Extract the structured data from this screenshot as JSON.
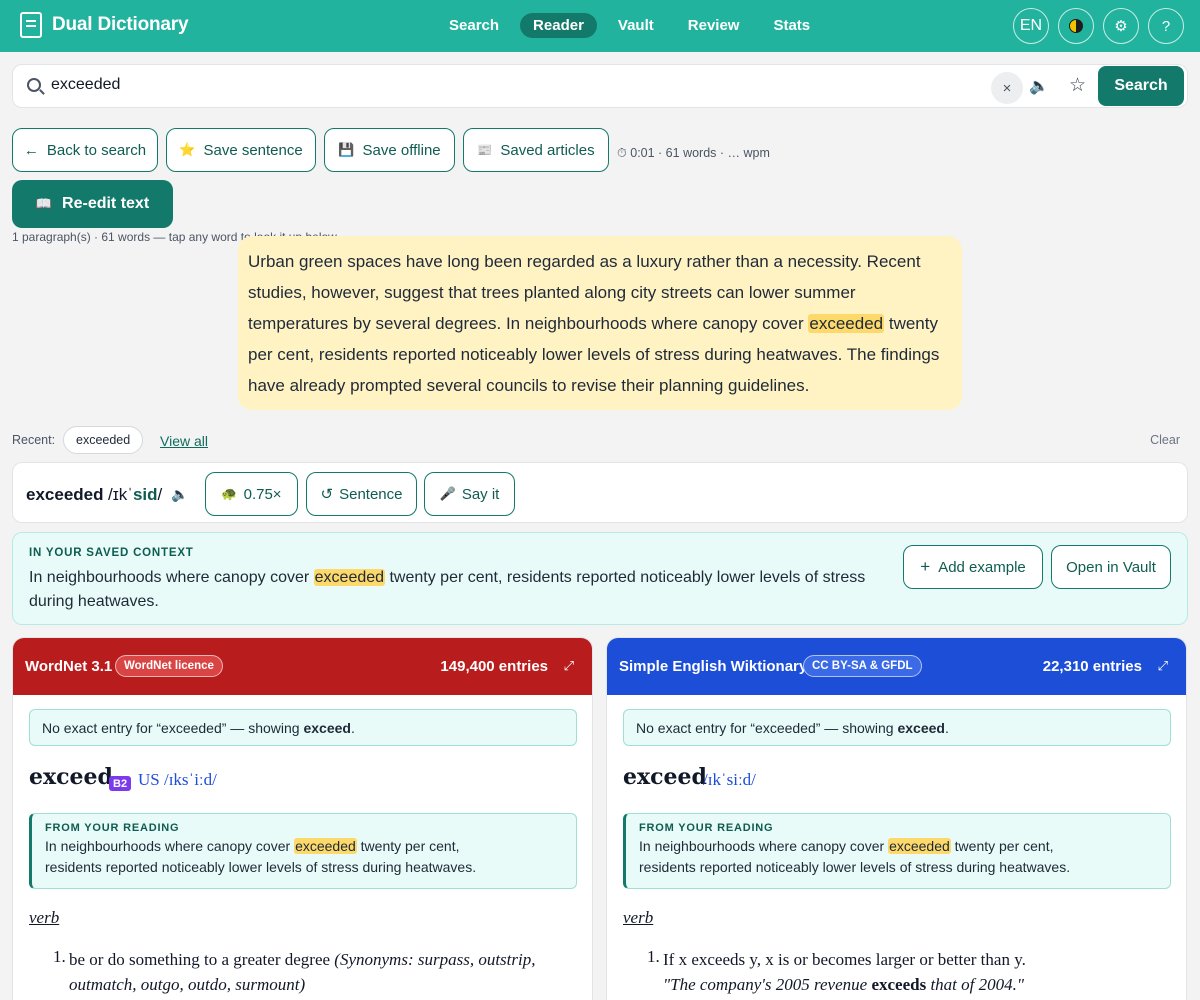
{
  "app": {
    "title": "Dual Dictionary"
  },
  "nav": [
    "Search",
    "Reader",
    "Vault",
    "Review",
    "Stats"
  ],
  "nav_active": "Reader",
  "top_actions": {
    "lang": "EN",
    "settings": "⚙",
    "help": "?"
  },
  "search": {
    "value": "exceeded",
    "clear": "×",
    "button": "Search"
  },
  "actions": {
    "back": "Back to search",
    "save_sentence": "Save sentence",
    "save_offline": "Save offline",
    "saved_articles": "Saved articles",
    "timer": "0:01 · 61 words · … wpm",
    "reedit": "Re-edit text",
    "para_meta": "1 paragraph(s) · 61 words — tap any word to look it up below."
  },
  "passage": {
    "before": "Urban green spaces have long been regarded as a luxury rather than a necessity. Recent studies, however, suggest that trees planted along city streets can lower summer temperatures by several degrees. In neighbourhoods where canopy cover ",
    "highlight": "exceeded",
    "after": " twenty per cent, residents reported noticeably lower levels of stress during heatwaves. The findings have already prompted several councils to revise their planning guidelines."
  },
  "recent": {
    "label": "Recent:",
    "chip": "exceeded",
    "view_all": "View all",
    "clear": "Clear"
  },
  "word": {
    "headword": "exceeded",
    "ipa_start": "/ɪkˈ",
    "ipa_stress": "sid",
    "ipa_end": "/",
    "speed": "0.75×",
    "sentence": "Sentence",
    "say_it": "Say it"
  },
  "context": {
    "label": "IN YOUR SAVED CONTEXT",
    "before": "In neighbourhoods where canopy cover ",
    "highlight": "exceeded",
    "after": " twenty per cent, residents reported noticeably lower levels of stress during heatwaves.",
    "add_example": "Add example",
    "open_vault": "Open in Vault"
  },
  "panes": [
    {
      "title": "WordNet 3.1",
      "licence": "WordNet licence",
      "entries": "149,400 entries",
      "color": "#b91c1c",
      "notice_before": "No exact entry for “exceeded” — showing ",
      "notice_word": "exceed",
      "notice_after": ".",
      "headword": "exceed",
      "level": "B2",
      "pron": "US /ɪksˈiːd/",
      "reading_label": "FROM YOUR READING",
      "reading_before": "In neighbourhoods where canopy cover ",
      "reading_highlight": "exceeded",
      "reading_after": " twenty per cent, residents reported noticeably lower levels of stress during heatwaves.",
      "pos": "verb",
      "def_num": "1.",
      "def_text": "be or do something to a greater degree ",
      "def_syn": "(Synonyms: surpass, outstrip, outmatch, outgo, outdo, surmount)"
    },
    {
      "title": "Simple English Wiktionary",
      "licence": "CC BY-SA & GFDL",
      "entries": "22,310 entries",
      "color": "#1d4ed8",
      "notice_before": "No exact entry for “exceeded” — showing ",
      "notice_word": "exceed",
      "notice_after": ".",
      "headword": "exceed",
      "pron": "/ɪkˈsiːd/",
      "reading_label": "FROM YOUR READING",
      "reading_before": "In neighbourhoods where canopy cover ",
      "reading_highlight": "exceeded",
      "reading_after": " twenty per cent, residents reported noticeably lower levels of stress during heatwaves.",
      "pos": "verb",
      "def_num": "1.",
      "def_text": "If x exceeds y, x is or becomes larger or better than y.",
      "example_before": "\"The company's 2005 revenue ",
      "example_word": "exceeds",
      "example_after": " that of 2004.\""
    }
  ]
}
